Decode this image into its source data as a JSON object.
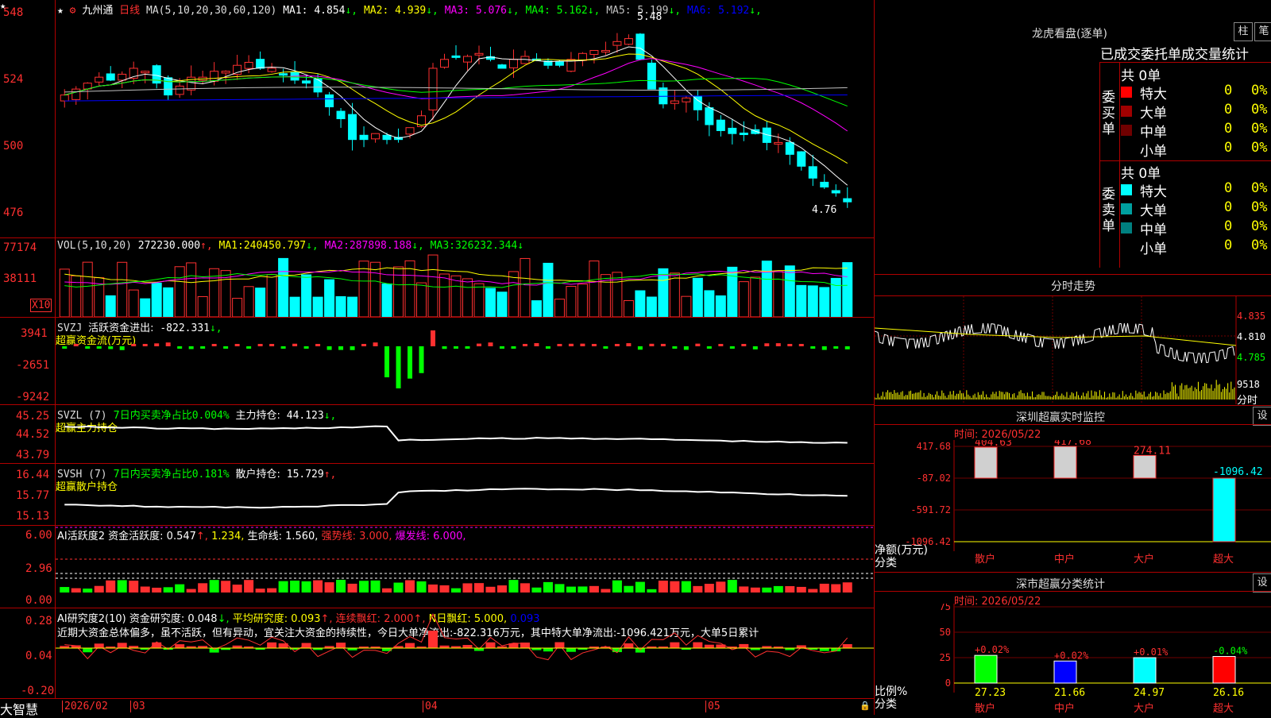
{
  "stock": {
    "name": "九州通",
    "period": "日线"
  },
  "price_pane": {
    "ma_header": "MA(5,10,20,30,60,120)",
    "mas": [
      {
        "label": "MA1:",
        "value": "4.854",
        "arrow": "↓",
        "color": "#ffffff"
      },
      {
        "label": "MA2:",
        "value": "4.939",
        "arrow": "↓",
        "color": "#ffff00"
      },
      {
        "label": "MA3:",
        "value": "5.076",
        "arrow": "↓",
        "color": "#ff00ff"
      },
      {
        "label": "MA4:",
        "value": "5.162",
        "arrow": "↓",
        "color": "#00ff00"
      },
      {
        "label": "MA5:",
        "value": "5.199",
        "arrow": "↓",
        "color": "#c0c0c0"
      },
      {
        "label": "MA6:",
        "value": "5.192",
        "arrow": "↓",
        "color": "#0000ff"
      }
    ],
    "y_labels": [
      "548",
      "524",
      "500",
      "476"
    ],
    "high_mark": "5.48",
    "low_mark": "4.76"
  },
  "vol_pane": {
    "header": "VOL(5,10,20)",
    "value": "272230.000",
    "mas": [
      {
        "label": "MA1:",
        "value": "240450.797",
        "color": "#ffff00"
      },
      {
        "label": "MA2:",
        "value": "287898.188",
        "color": "#ff00ff"
      },
      {
        "label": "MA3:",
        "value": "326232.344",
        "color": "#00ff00"
      }
    ],
    "y_labels": [
      "77174",
      "38111"
    ],
    "unit": "X10"
  },
  "svzj_pane": {
    "header": "SVZJ",
    "label": "活跃资金进出:",
    "value": "-822.331",
    "subtitle": "超赢资金流(万元)",
    "y_labels": [
      "3941",
      "-2651",
      "-9242"
    ]
  },
  "svzl_pane": {
    "header": "SVZL (7)",
    "label1": "7日内买卖净占比",
    "value1": "0.004%",
    "label2": "主力持仓:",
    "value2": "44.123",
    "subtitle": "超赢主力持仓",
    "y_labels": [
      "45.25",
      "44.52",
      "43.79"
    ]
  },
  "svsh_pane": {
    "header": "SVSH (7)",
    "label1": "7日内买卖净占比",
    "value1": "0.181%",
    "label2": "散户持仓:",
    "value2": "15.729",
    "subtitle": "超赢散户持仓",
    "y_labels": [
      "16.44",
      "15.77",
      "15.13"
    ]
  },
  "ai1_pane": {
    "header": "AI活跃度2",
    "label1": "资金活跃度:",
    "value1": "0.547",
    "value2": "1.234,",
    "label3": "生命线:",
    "value3": "1.560,",
    "label4": "强势线:",
    "value4": "3.000,",
    "label5": "爆发线:",
    "value5": "6.000,",
    "y_labels": [
      "6.00",
      "2.96",
      "0.00"
    ]
  },
  "ai2_pane": {
    "header": "AI研究度2(10)",
    "label1": "资金研究度:",
    "value1": "0.048",
    "label2": "平均研究度:",
    "value2": "0.093",
    "label3": "连续飘红:",
    "value3": "2.000",
    "label4": "N日飘红:",
    "value4": "5.000,",
    "value5": "0.093",
    "comment": "近期大资金总体偏多，虽不活跃，但有异动，宜关注大资金的持续性，今日大单净流出:-822.316万元，其中特大单净流出:-1096.421万元，大单5日累计",
    "y_labels": [
      "0.28",
      "0.04",
      "-0.20"
    ]
  },
  "date_axis": {
    "brand": "大智慧",
    "labels": [
      "2026/02",
      "03",
      "04",
      "05"
    ]
  },
  "dragon": {
    "title": "龙虎看盘(逐单)",
    "btn1": "柱",
    "btn2": "笔",
    "subtitle": "已成交委托单成交量统计",
    "buy_side": "委买单",
    "sell_side": "委卖单",
    "buy_total": "共 0单",
    "sell_total": "共 0单",
    "buy_rows": [
      {
        "label": "特大",
        "count": "0",
        "pct": "0%",
        "color": "#ff0000"
      },
      {
        "label": "大单",
        "count": "0",
        "pct": "0%",
        "color": "#a00000"
      },
      {
        "label": "中单",
        "count": "0",
        "pct": "0%",
        "color": "#700000"
      },
      {
        "label": "小单",
        "count": "0",
        "pct": "0%",
        "color": ""
      }
    ],
    "sell_rows": [
      {
        "label": "特大",
        "count": "0",
        "pct": "0%",
        "color": "#00ffff"
      },
      {
        "label": "大单",
        "count": "0",
        "pct": "0%",
        "color": "#00a0a0"
      },
      {
        "label": "中单",
        "count": "0",
        "pct": "0%",
        "color": "#008080"
      },
      {
        "label": "小单",
        "count": "0",
        "pct": "0%",
        "color": ""
      }
    ]
  },
  "intraday": {
    "title": "分时走势",
    "y_labels": [
      "4.835",
      "4.810",
      "4.785"
    ],
    "vol_label": "9518",
    "foot": "分时"
  },
  "realtime": {
    "title": "深圳超赢实时监控",
    "setting": "设",
    "time": "时间: 2026/05/22",
    "y_labels": [
      "417.68",
      "-87.02",
      "-591.72",
      "-1096.42"
    ],
    "axis_name": "净额(万元)",
    "axis_name2": "分类",
    "bars": [
      {
        "cat": "散户",
        "value": "404.63"
      },
      {
        "cat": "中户",
        "value": "417.68"
      },
      {
        "cat": "大户",
        "value": "274.11"
      },
      {
        "cat": "超大",
        "value": "-1096.42"
      }
    ]
  },
  "category": {
    "title": "深市超赢分类统计",
    "setting": "设",
    "time": "时间: 2026/05/22",
    "y_labels": [
      "75",
      "50",
      "25",
      "0"
    ],
    "axis_name": "比例%",
    "axis_name2": "分类",
    "bars": [
      {
        "cat": "散户",
        "pct": "+0.02%",
        "value": "27.23",
        "color": "#00ff00"
      },
      {
        "cat": "中户",
        "pct": "+0.02%",
        "value": "21.66",
        "color": "#0000ff"
      },
      {
        "cat": "大户",
        "pct": "+0.01%",
        "value": "24.97",
        "color": "#00ffff"
      },
      {
        "cat": "超大",
        "pct": "-0.04%",
        "value": "26.16",
        "color": "#ff0000"
      }
    ]
  }
}
